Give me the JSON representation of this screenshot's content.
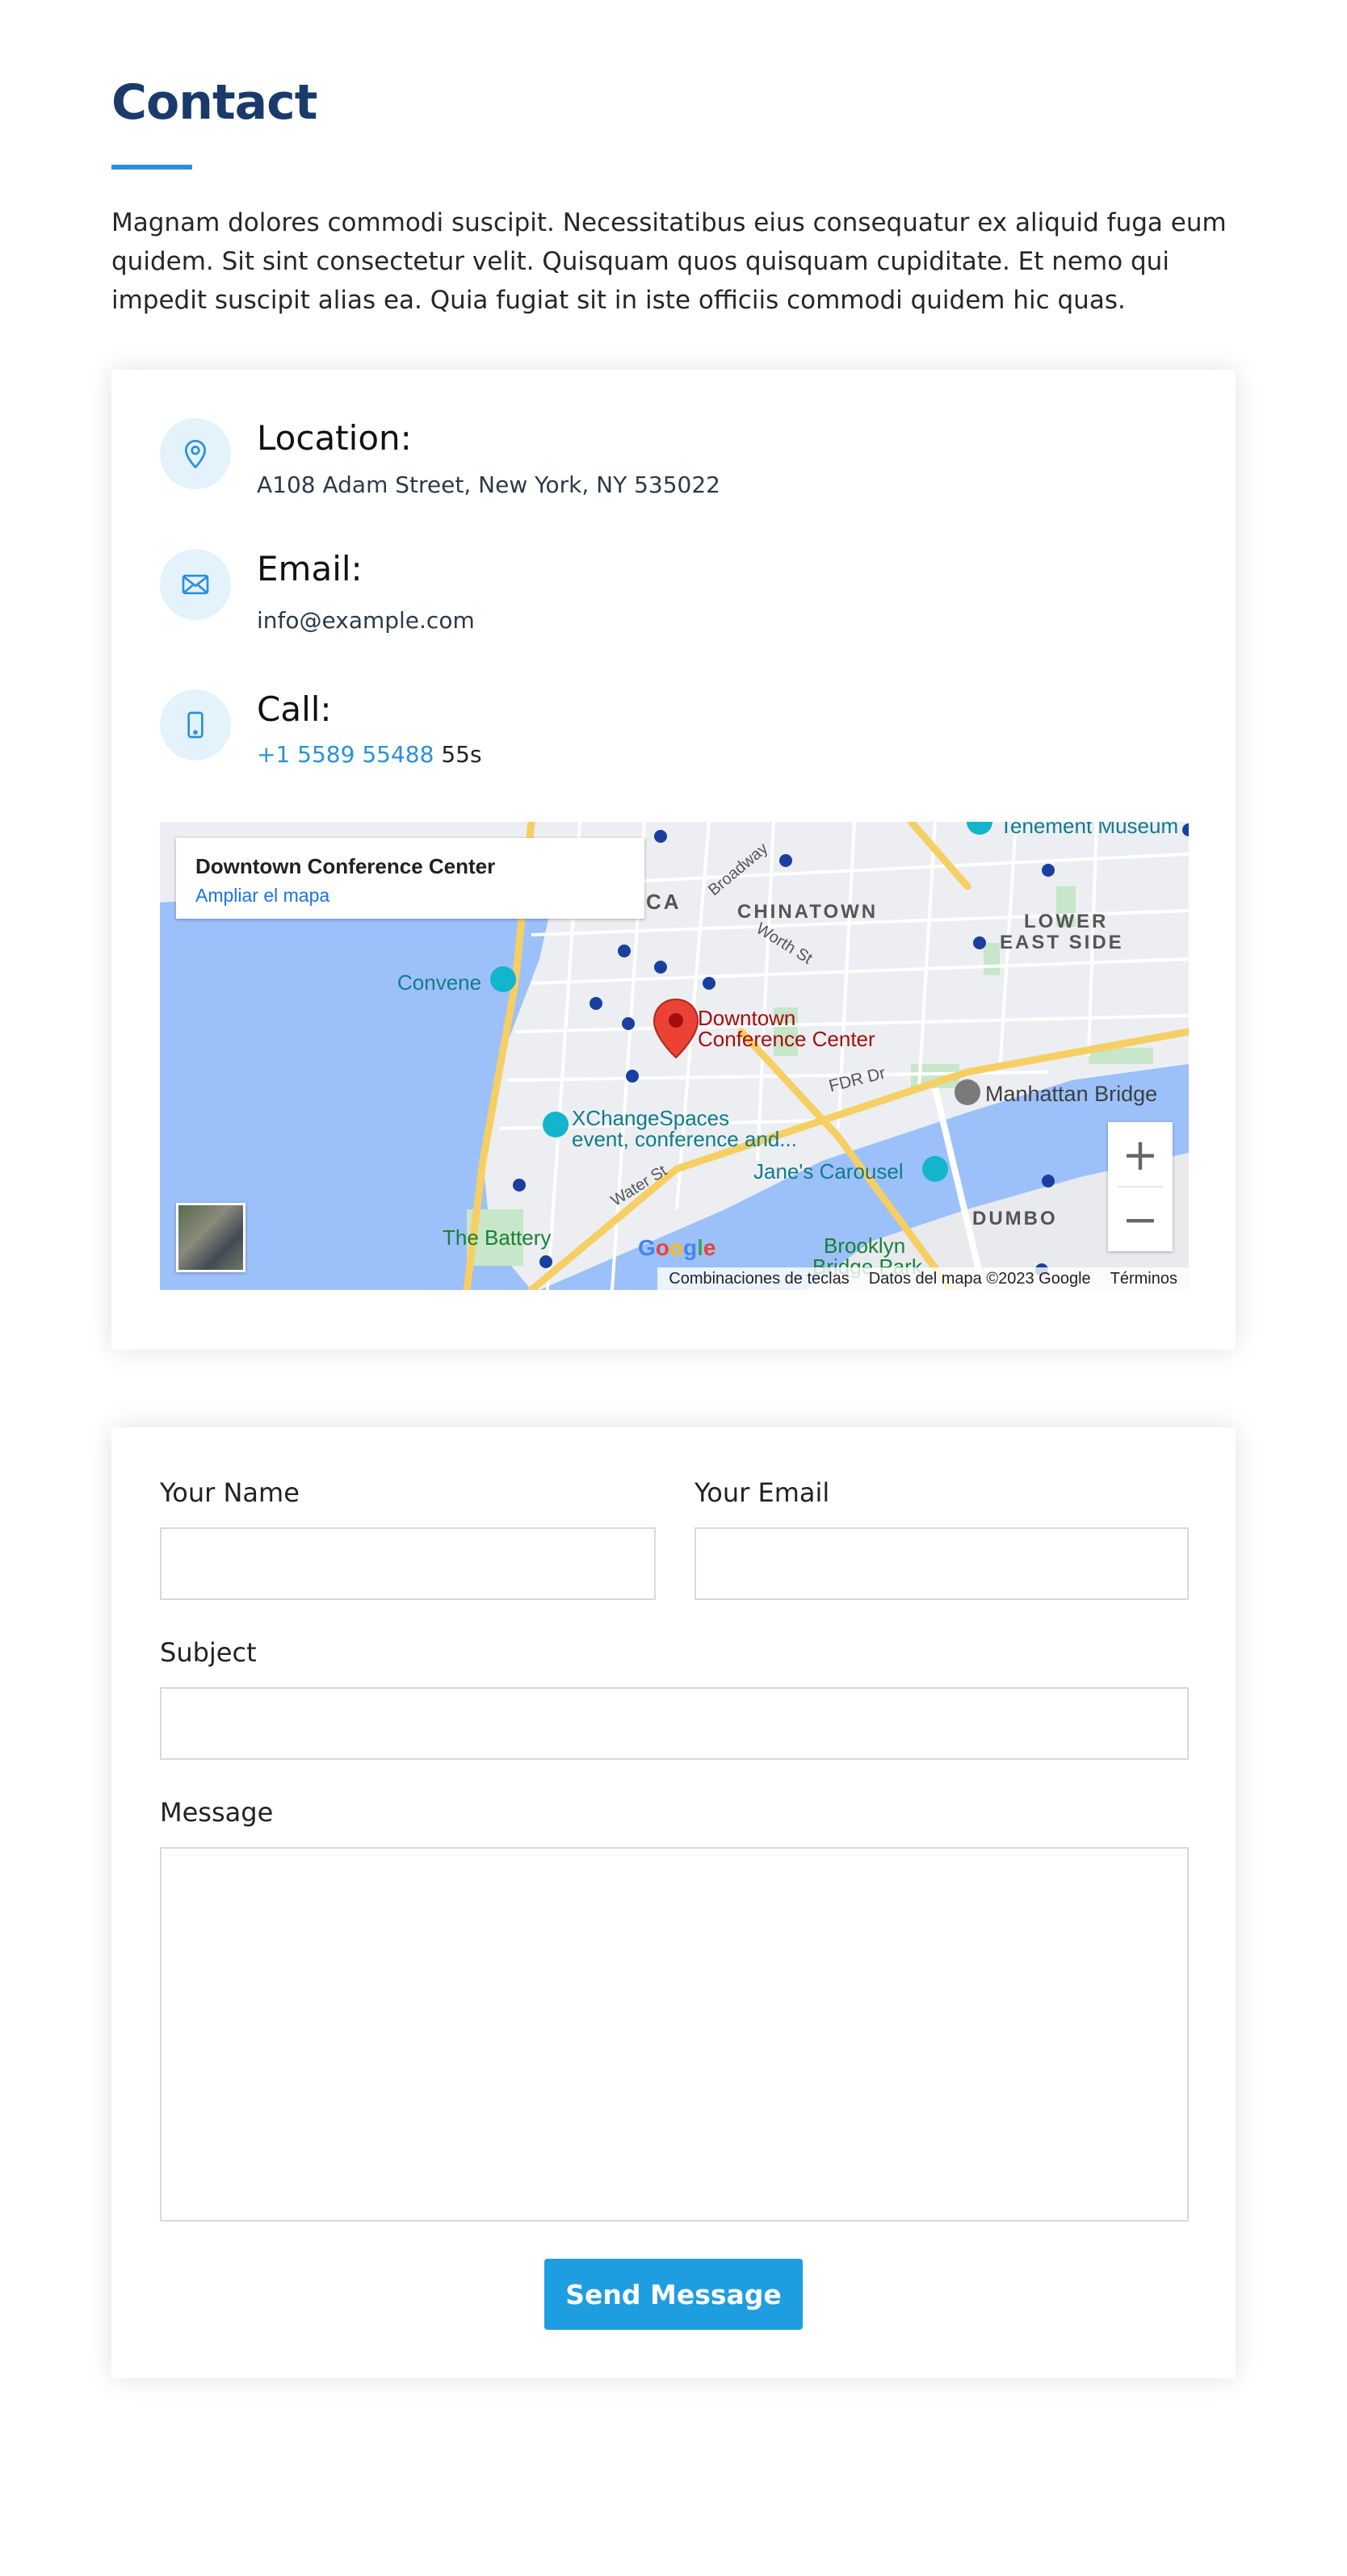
{
  "section": {
    "title": "Contact",
    "intro": "Magnam dolores commodi suscipit. Necessitatibus eius consequatur ex aliquid fuga eum quidem. Sit sint consectetur velit. Quisquam quos quisquam cupiditate. Et nemo qui impedit suscipit alias ea. Quia fugiat sit in iste officiis commodi quidem hic quas."
  },
  "info": {
    "location": {
      "label": "Location:",
      "value": "A108 Adam Street, New York, NY 535022",
      "icon": "map-pin-icon"
    },
    "email": {
      "label": "Email:",
      "value": "info@example.com",
      "icon": "envelope-icon"
    },
    "call": {
      "label": "Call:",
      "link": "+1 5589 55488",
      "suffix": "55s",
      "icon": "phone-icon"
    }
  },
  "map": {
    "place_name": "Downtown Conference Center",
    "view_larger": "Ampliar el mapa",
    "pin_label_line1": "Downtown",
    "pin_label_line2": "Conference Center",
    "labels": {
      "chinatown": "CHINATOWN",
      "lower_east_side_1": "LOWER",
      "lower_east_side_2": "EAST SIDE",
      "convene": "Convene",
      "manhattan_bridge": "Manhattan Bridge",
      "xchange_1": "XChangeSpaces",
      "xchange_2": "event, conference and...",
      "janes_carousel": "Jane's Carousel",
      "dumbo": "DUMBO",
      "the_battery": "The Battery",
      "brooklyn_1": "Brooklyn",
      "brooklyn_2": "Bridge Park",
      "fdr_dr": "FDR Dr",
      "water_st": "Water St",
      "worth_st": "Worth St",
      "broadway": "Broadway",
      "ca": "CA",
      "tenement": "Tenement Museum"
    },
    "zoom_in": "+",
    "zoom_out": "−",
    "google": "Google",
    "footer": {
      "shortcuts": "Combinaciones de teclas",
      "map_data": "Datos del mapa ©2023 Google",
      "terms": "Términos"
    }
  },
  "form": {
    "name_label": "Your Name",
    "email_label": "Your Email",
    "subject_label": "Subject",
    "message_label": "Message",
    "name_value": "",
    "email_value": "",
    "subject_value": "",
    "message_value": "",
    "submit_label": "Send Message"
  },
  "colors": {
    "title": "#1a3a6b",
    "accent": "#2b90d9",
    "button": "#1e9ee0",
    "icon_bg": "#e3f2fb"
  }
}
